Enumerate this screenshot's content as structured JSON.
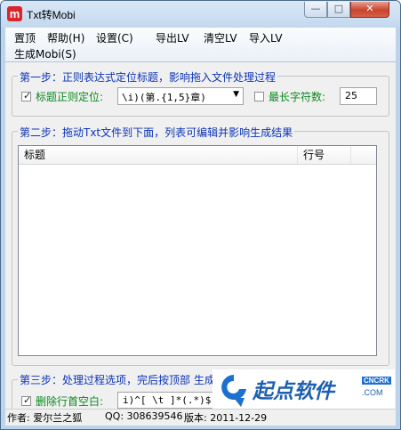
{
  "window": {
    "title": "Txt转Mobi",
    "icon_letter": "m"
  },
  "controls": {
    "minimize": "—",
    "maximize": "□",
    "close": "✕"
  },
  "menu": {
    "top": "置顶",
    "help": "帮助(H)",
    "settings": "设置(C)",
    "export_lv": "导出LV",
    "clear_lv": "清空LV",
    "import_lv": "导入LV",
    "generate": "生成Mobi(S)"
  },
  "step1": {
    "legend": "第一步：正则表达式定位标题，影响拖入文件处理过程",
    "regex_checked": true,
    "regex_label": "标题正则定位:",
    "regex_value": "\\i)(第.{1,5}章)",
    "maxlen_checked": false,
    "maxlen_label": "最长字符数:",
    "maxlen_value": "25"
  },
  "step2": {
    "legend": "第二步：拖动Txt文件到下面，列表可编辑并影响生成结果",
    "columns": [
      "标题",
      "行号"
    ],
    "rows": []
  },
  "step3": {
    "legend": "第三步：处理过程选项，完后按顶部 生成",
    "trim_checked": true,
    "trim_label": "删除行首空白:",
    "trim_value": "i)^[ \\t ]*(.*)$"
  },
  "status": {
    "author": "作者: 爱尔兰之狐",
    "qq": "QQ: 308639546",
    "version": "版本: 2011-12-29"
  },
  "watermark": {
    "text": "起点软件",
    "badge": "CNCRK",
    "sub": ".COM"
  },
  "colors": {
    "legend": "#0b34b8",
    "green_label": "#0b8a1e",
    "close_button": "#c9442d"
  }
}
